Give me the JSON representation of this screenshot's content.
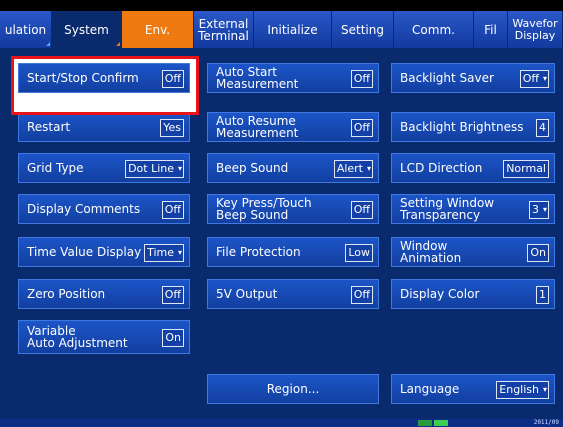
{
  "tabs": [
    {
      "label": "ulation"
    },
    {
      "label": "System"
    },
    {
      "label": "Env."
    },
    {
      "label": "External\nTerminal"
    },
    {
      "label": "Initialize"
    },
    {
      "label": "Setting"
    },
    {
      "label": "Comm."
    },
    {
      "label": "Fil"
    },
    {
      "label": "Wavefor\nDisplay"
    }
  ],
  "col1": [
    {
      "label": "Start/Stop Confirm",
      "value": "Off"
    },
    {
      "label": "Restart",
      "value": "Yes"
    },
    {
      "label": "Grid Type",
      "value": "Dot Line"
    },
    {
      "label": "Display Comments",
      "value": "Off"
    },
    {
      "label": "Time Value Display",
      "value": "Time"
    },
    {
      "label": "Zero Position",
      "value": "Off"
    },
    {
      "label": "Variable\nAuto Adjustment",
      "value": "On"
    }
  ],
  "col2": [
    {
      "label": "Auto Start\nMeasurement",
      "value": "Off"
    },
    {
      "label": "Auto Resume\nMeasurement",
      "value": "Off"
    },
    {
      "label": "Beep Sound",
      "value": "Alert"
    },
    {
      "label": "Key Press/Touch\nBeep Sound",
      "value": "Off"
    },
    {
      "label": "File Protection",
      "value": "Low"
    },
    {
      "label": "5V Output",
      "value": "Off"
    }
  ],
  "col3": [
    {
      "label": "Backlight Saver",
      "value": "Off"
    },
    {
      "label": "Backlight Brightness",
      "value": "4"
    },
    {
      "label": "LCD Direction",
      "value": "Normal"
    },
    {
      "label": "Setting Window\nTransparency",
      "value": "3"
    },
    {
      "label": "Window\nAnimation",
      "value": "On"
    },
    {
      "label": "Display Color",
      "value": "1"
    }
  ],
  "region": {
    "label": "Region..."
  },
  "language": {
    "label": "Language",
    "value": "English"
  },
  "status": {
    "date": "2011/09"
  }
}
